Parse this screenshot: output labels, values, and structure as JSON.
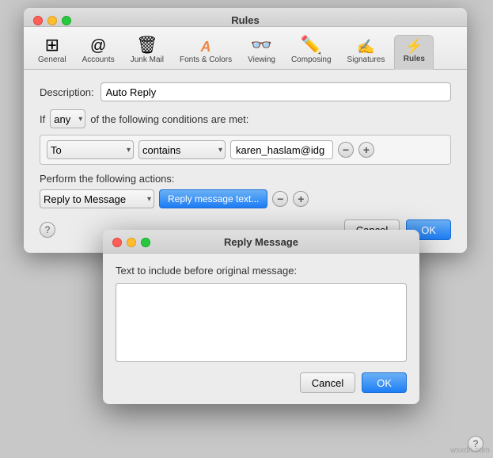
{
  "app": {
    "title": "Rules",
    "reply_dialog_title": "Reply Message"
  },
  "toolbar": {
    "items": [
      {
        "id": "general",
        "label": "General",
        "icon": "⊞"
      },
      {
        "id": "accounts",
        "label": "Accounts",
        "icon": "@"
      },
      {
        "id": "junk-mail",
        "label": "Junk Mail",
        "icon": "🗑"
      },
      {
        "id": "fonts-colors",
        "label": "Fonts & Colors",
        "icon": "A"
      },
      {
        "id": "viewing",
        "label": "Viewing",
        "icon": "👓"
      },
      {
        "id": "composing",
        "label": "Composing",
        "icon": "✏"
      },
      {
        "id": "signatures",
        "label": "Signatures",
        "icon": "✍"
      },
      {
        "id": "rules",
        "label": "Rules",
        "icon": "⚡",
        "active": true
      }
    ]
  },
  "rules_form": {
    "description_label": "Description:",
    "description_value": "Auto Reply",
    "if_label": "If",
    "any_option": "any",
    "conditions_label": "of the following conditions are met:",
    "condition": {
      "field": "To",
      "operator": "contains",
      "value": "karen_haslam@idg"
    },
    "actions_label": "Perform the following actions:",
    "action": {
      "type": "Reply to Message",
      "button_label": "Reply message text..."
    },
    "cancel_label": "Cancel",
    "ok_label": "OK",
    "help_label": "?"
  },
  "reply_dialog": {
    "text_label": "Text to include before original message:",
    "text_value": "",
    "cancel_label": "Cancel",
    "ok_label": "OK"
  },
  "watermark": "wsxdn.com"
}
